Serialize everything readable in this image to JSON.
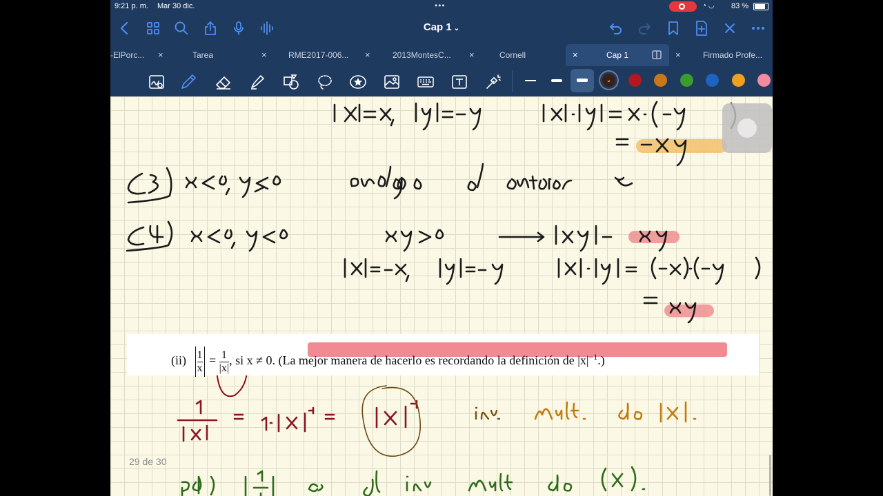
{
  "status": {
    "time": "9:21 p. m.",
    "date": "Mar 30 dic.",
    "battery": "83 %"
  },
  "nav": {
    "title": "Cap 1",
    "icons": [
      "back-icon",
      "grid-icon",
      "search-icon",
      "share-icon",
      "microphone-icon",
      "audio-wave-icon",
      "undo-icon",
      "redo-icon",
      "bookmark-icon",
      "add-page-icon",
      "close-icon",
      "more-icon"
    ]
  },
  "tabs": [
    {
      "label": "-ElPorc..."
    },
    {
      "label": "Tarea"
    },
    {
      "label": "RME2017-006..."
    },
    {
      "label": "2013MontesC..."
    },
    {
      "label": "Cornell"
    },
    {
      "label": "Cap 1",
      "active": true
    },
    {
      "label": "Firmado Profe..."
    }
  ],
  "toolbar": {
    "tools": [
      "zoom-pen-icon",
      "pen-icon",
      "eraser-icon",
      "highlighter-icon",
      "shapes-icon",
      "lasso-icon",
      "sticker-icon",
      "image-icon",
      "keyboard-icon",
      "text-icon",
      "laser-icon"
    ],
    "colors": [
      "#3a1f14",
      "#b01822",
      "#c8781a",
      "#3b9b2e",
      "#1e63c0",
      "#f0a020",
      "#f28aa0"
    ]
  },
  "excerpt": {
    "label": "(ii)",
    "num": "1",
    "den_x": "x",
    "den_abs": "|x|",
    "eq": "=",
    "cond": ", si x ≠ 0.",
    "note": "(La mejor manera de hacerlo es recordando la definición de |x|",
    "sup": "−1",
    "note_end": ".)"
  },
  "page_indicator": "29 de 30"
}
